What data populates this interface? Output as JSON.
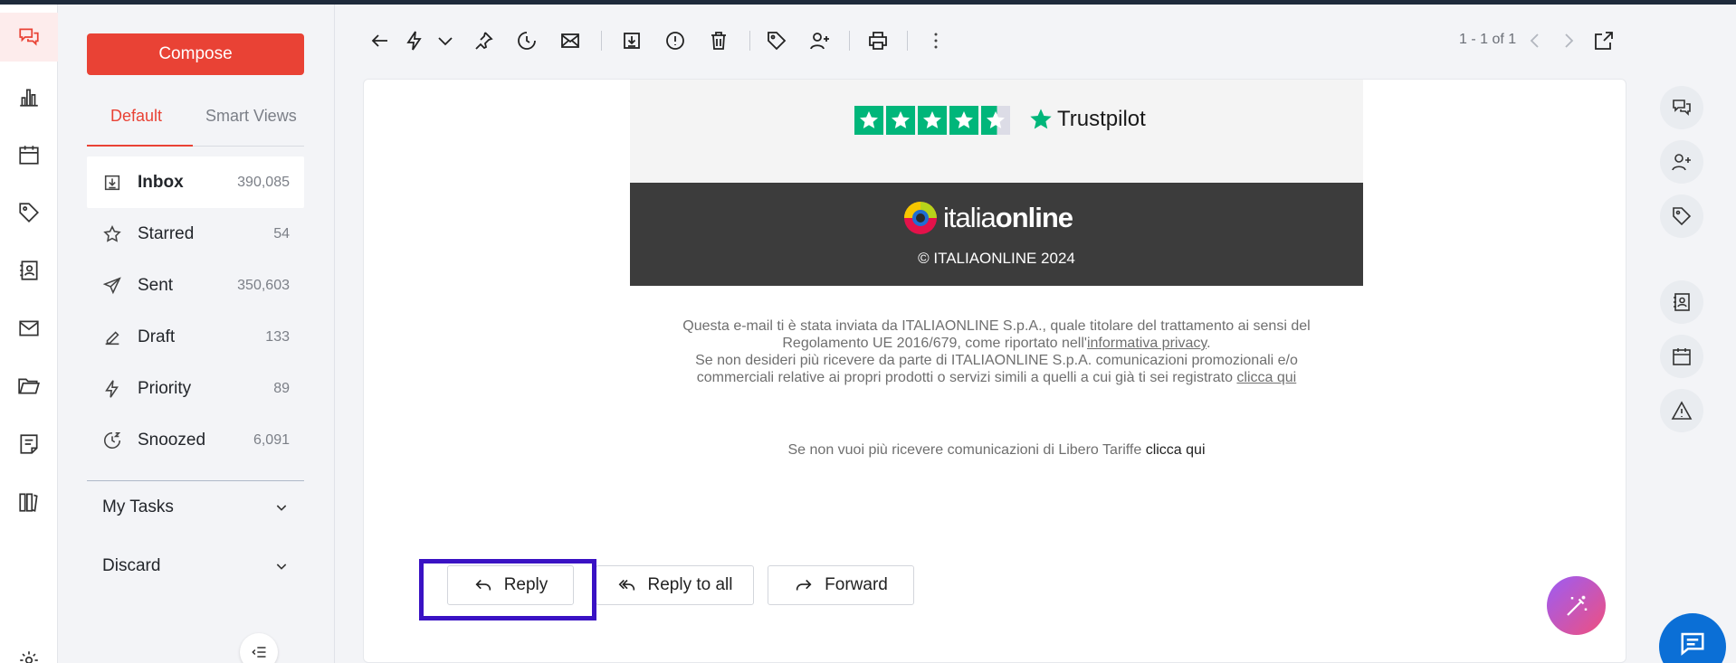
{
  "app": {
    "accent": "#e94235"
  },
  "compose_label": "Compose",
  "view_tabs": [
    {
      "label": "Default"
    },
    {
      "label": "Smart Views"
    }
  ],
  "folders": [
    {
      "name": "Inbox",
      "count": "390,085",
      "icon": "inbox-icon"
    },
    {
      "name": "Starred",
      "count": "54",
      "icon": "star-icon"
    },
    {
      "name": "Sent",
      "count": "350,603",
      "icon": "send-icon"
    },
    {
      "name": "Draft",
      "count": "133",
      "icon": "draft-icon"
    },
    {
      "name": "Priority",
      "count": "89",
      "icon": "lightning-icon"
    },
    {
      "name": "Snoozed",
      "count": "6,091",
      "icon": "snooze-icon"
    }
  ],
  "sections": [
    {
      "label": "My Tasks"
    },
    {
      "label": "Discard"
    }
  ],
  "toolbar": {
    "pager": "1 - 1 of 1"
  },
  "email": {
    "trustpilot": "Trustpilot",
    "logo_text_light": "italia",
    "logo_text_bold": "online",
    "copyright": "© ITALIAONLINE 2024",
    "legal_line1": "Questa e-mail ti è stata inviata da ITALIAONLINE S.p.A., quale titolare del trattamento ai sensi del",
    "legal_line2a": "Regolamento UE 2016/679, come riportato nell'",
    "legal_link1": "informativa privacy",
    "legal_line2b": ".",
    "legal_line3": "Se non desideri più ricevere da parte di ITALIAONLINE S.p.A. comunicazioni promozionali e/o",
    "legal_line4": "commerciali relative ai propri prodotti o servizi simili a quelli a cui già ti sei registrato ",
    "legal_link2": "clicca qui",
    "unsub_text": "Se non vuoi più ricevere comunicazioni di Libero Tariffe ",
    "unsub_link": "clicca qui"
  },
  "actions": {
    "reply": "Reply",
    "reply_all": "Reply to all",
    "forward": "Forward"
  }
}
